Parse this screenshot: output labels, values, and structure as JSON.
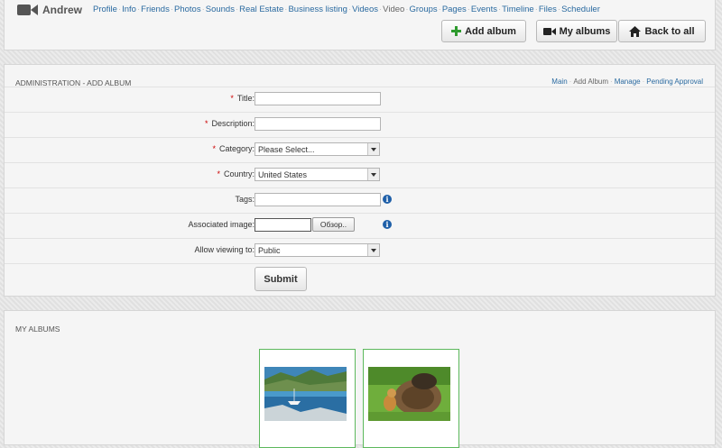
{
  "header": {
    "user_name": "Andrew",
    "nav": [
      {
        "label": "Profile",
        "current": false
      },
      {
        "label": "Info",
        "current": false
      },
      {
        "label": "Friends",
        "current": false
      },
      {
        "label": "Photos",
        "current": false
      },
      {
        "label": "Sounds",
        "current": false
      },
      {
        "label": "Real Estate",
        "current": false
      },
      {
        "label": "Business listing",
        "current": false
      },
      {
        "label": "Videos",
        "current": false
      },
      {
        "label": "Video",
        "current": true
      },
      {
        "label": "Groups",
        "current": false
      },
      {
        "label": "Pages",
        "current": false
      },
      {
        "label": "Events",
        "current": false
      },
      {
        "label": "Timeline",
        "current": false
      },
      {
        "label": "Files",
        "current": false
      },
      {
        "label": "Scheduler",
        "current": false
      }
    ],
    "buttons": {
      "add_album": "Add album",
      "my_albums": "My albums",
      "back_to_all": "Back to all"
    }
  },
  "admin": {
    "heading": "ADMINISTRATION - ADD ALBUM",
    "crumbs": [
      {
        "label": "Main",
        "link": true
      },
      {
        "label": "Add Album",
        "link": false
      },
      {
        "label": "Manage",
        "link": true
      },
      {
        "label": "Pending Approval",
        "link": true
      }
    ],
    "form": {
      "title_label": "Title:",
      "description_label": "Description:",
      "category_label": "Category:",
      "category_value": "Please Select...",
      "country_label": "Country:",
      "country_value": "United States",
      "tags_label": "Tags:",
      "image_label": "Associated image:",
      "browse_label": "Обзор..",
      "viewing_label": "Allow viewing to:",
      "viewing_value": "Public",
      "submit_label": "Submit",
      "required_mark": "*",
      "info_glyph": "i"
    }
  },
  "albums": {
    "heading": "MY ALBUMS",
    "items": [
      {
        "name": "album-lake-boat"
      },
      {
        "name": "album-cat-dog"
      }
    ]
  },
  "icons": [
    "video-camera-icon",
    "plus-icon",
    "video-icon",
    "home-icon",
    "info-icon"
  ],
  "colors": {
    "link": "#2a6aa0",
    "required": "#cc0000",
    "album_border": "#5cb85c",
    "info": "#1e5fa8"
  }
}
